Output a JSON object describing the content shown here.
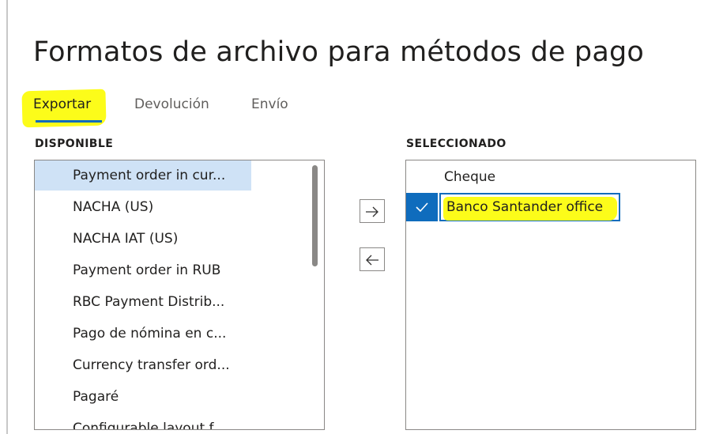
{
  "page": {
    "title": "Formatos de archivo para métodos de pago"
  },
  "tabs": [
    {
      "label": "Exportar",
      "active": true
    },
    {
      "label": "Devolución",
      "active": false
    },
    {
      "label": "Envío",
      "active": false
    }
  ],
  "available": {
    "header": "DISPONIBLE",
    "items": [
      "Payment order in cur...",
      "NACHA (US)",
      "NACHA IAT (US)",
      "Payment order in RUB",
      "RBC Payment Distrib...",
      "Pago de nómina en c...",
      "Currency transfer ord...",
      "Pagaré",
      "Configurable layout f..."
    ]
  },
  "selected": {
    "header": "SELECCIONADO",
    "items": [
      "Cheque",
      "Banco Santander office"
    ]
  },
  "transfer": {
    "add_icon": "arrow-right-icon",
    "remove_icon": "arrow-left-icon"
  },
  "colors": {
    "accent": "#0f6cbd",
    "row_highlight": "#cfe2f6",
    "marker_highlight": "#fcfc1a"
  }
}
